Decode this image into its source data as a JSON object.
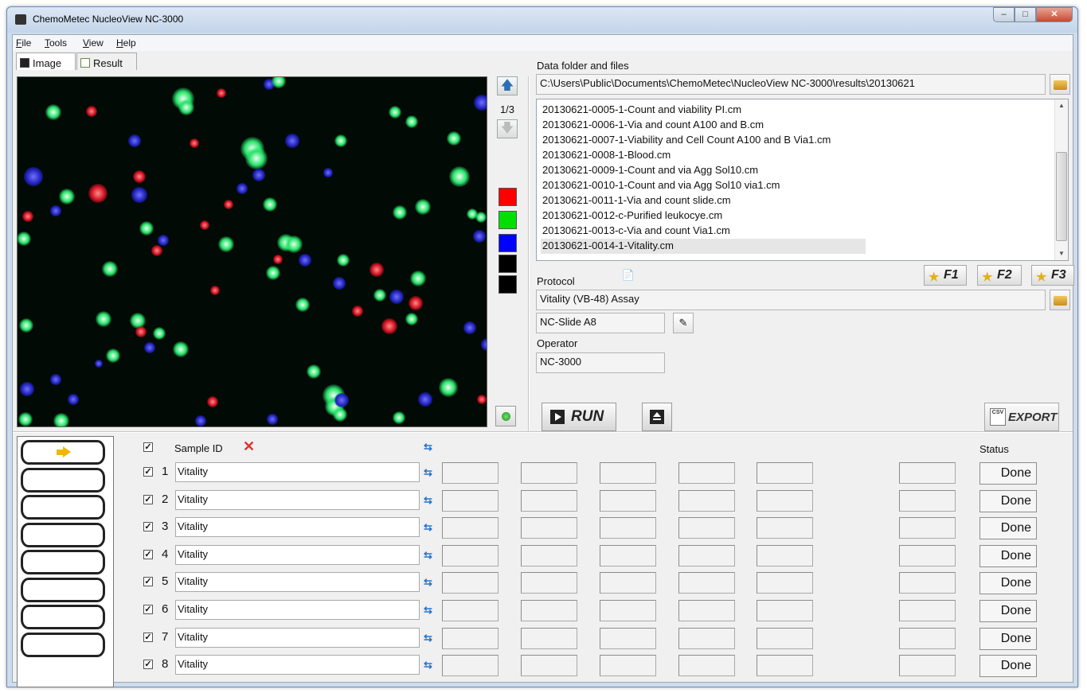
{
  "window": {
    "title": "ChemoMetec NucleoView NC-3000",
    "controls": {
      "minimize": "–",
      "maximize": "□",
      "close": "✕"
    }
  },
  "menu": [
    "File",
    "Tools",
    "View",
    "Help"
  ],
  "tabs": [
    "Image",
    "Result"
  ],
  "image_nav": {
    "page": "1/3",
    "swatch_colors": [
      "#ff0000",
      "#00e000",
      "#0000ff",
      "#000000",
      "#000000"
    ]
  },
  "data_section": {
    "label": "Data folder and files",
    "path": "C:\\Users\\Public\\Documents\\ChemoMetec\\NucleoView NC-3000\\results\\20130621",
    "files": [
      "20130621-0005-1-Count and viability PI.cm",
      "20130621-0006-1-Via and count A100 and B.cm",
      "20130621-0007-1-Viability and Cell Count A100 and B Via1.cm",
      "20130621-0008-1-Blood.cm",
      "20130621-0009-1-Count and via Agg Sol10.cm",
      "20130621-0010-1-Count and via Agg Sol10 via1.cm",
      "20130621-0011-1-Via and count slide.cm",
      "20130621-0012-c-Purified leukocye.cm",
      "20130621-0013-c-Via and count Via1.cm",
      "20130621-0014-1-Vitality.cm"
    ],
    "selected_index": 9
  },
  "protocol": {
    "label": "Protocol",
    "value": "Vitality (VB-48) Assay",
    "slide": "NC-Slide A8",
    "favorites": [
      "F1",
      "F2",
      "F3"
    ]
  },
  "operator": {
    "label": "Operator",
    "value": "NC-3000"
  },
  "actions": {
    "run": "RUN",
    "export": "EXPORT",
    "csv": "CSV"
  },
  "samples": {
    "header_sample_id": "Sample ID",
    "header_status": "Status",
    "rows": [
      {
        "num": "1",
        "id": "Vitality",
        "status": "Done"
      },
      {
        "num": "2",
        "id": "Vitality",
        "status": "Done"
      },
      {
        "num": "3",
        "id": "Vitality",
        "status": "Done"
      },
      {
        "num": "4",
        "id": "Vitality",
        "status": "Done"
      },
      {
        "num": "5",
        "id": "Vitality",
        "status": "Done"
      },
      {
        "num": "6",
        "id": "Vitality",
        "status": "Done"
      },
      {
        "num": "7",
        "id": "Vitality",
        "status": "Done"
      },
      {
        "num": "8",
        "id": "Vitality",
        "status": "Done"
      }
    ]
  }
}
